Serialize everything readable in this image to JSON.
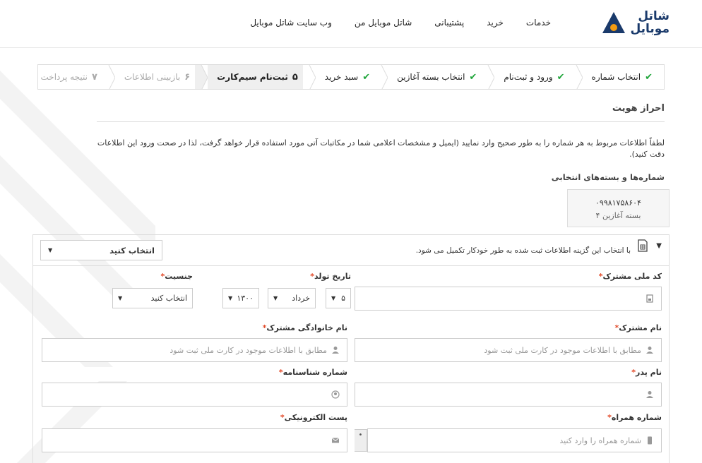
{
  "brand": {
    "line1": "شاتل",
    "line2": "موبایل"
  },
  "nav": [
    "خدمات",
    "خرید",
    "پشتیبانی",
    "شاتل موبایل من",
    "وب سایت شاتل موبایل"
  ],
  "steps": [
    {
      "label": "انتخاب شماره",
      "state": "done"
    },
    {
      "label": "ورود و ثبت‌نام",
      "state": "done"
    },
    {
      "label": "انتخاب بسته آغازین",
      "state": "done"
    },
    {
      "label": "سبد خرید",
      "state": "done"
    },
    {
      "label": "ثبت‌نام سیم‌کارت",
      "num": "۵",
      "state": "active"
    },
    {
      "label": "بازبینی اطلاعات",
      "num": "۶",
      "state": "disabled"
    },
    {
      "label": "نتیجه پرداخت",
      "num": "۷",
      "state": "disabled"
    }
  ],
  "section_title": "احراز هویت",
  "description": "لطفاً اطلاعات مربوط به هر شماره را به طور صحیح وارد نمایید (ایمیل و مشخصات اعلامی شما در مکاتبات آتی مورد استفاده قرار خواهد گرفت، لذا در صحت ورود این اطلاعات دقت کنید).",
  "selected_title": "شماره‌ها و بسته‌های انتخابی",
  "package": {
    "number": "۰۹۹۸۱۷۵۸۶۰۴",
    "name": "بسته آغازین ۴"
  },
  "autofill_text": "با انتخاب این گزینه اطلاعات ثبت شده به طور خودکار تکمیل می شود.",
  "autofill_select": "انتخاب کنید",
  "form": {
    "national_code": {
      "label": "کد ملی مشترک"
    },
    "birth_date": {
      "label": "تاریخ تولد",
      "day": "۵",
      "month": "خرداد",
      "year": "۱۳۰۰"
    },
    "gender": {
      "label": "جنسیت",
      "value": "انتخاب کنید"
    },
    "first_name": {
      "label": "نام مشترک",
      "placeholder": "مطابق با اطلاعات موجود در کارت ملی ثبت شود"
    },
    "last_name": {
      "label": "نام خانوادگی مشترک",
      "placeholder": "مطابق با اطلاعات موجود در کارت ملی ثبت شود"
    },
    "father_name": {
      "label": "نام پدر"
    },
    "id_number": {
      "label": "شماره شناسنامه"
    },
    "mobile": {
      "label": "شماره همراه",
      "placeholder": "شماره همراه را وارد کنید",
      "prefix": "•"
    },
    "email": {
      "label": "پست الکترونیکی"
    },
    "required_mark": "*"
  },
  "colors": {
    "check": "#1fa53a",
    "required": "#e34b2a",
    "brand_blue": "#1a3a6b",
    "brand_orange": "#f39c12"
  }
}
